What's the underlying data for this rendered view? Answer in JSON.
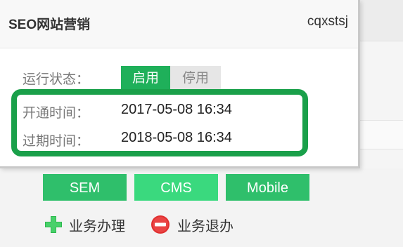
{
  "popup": {
    "title": "SEO网站营销",
    "user": "cqxstsj"
  },
  "status": {
    "label": "运行状态：",
    "on_label": "启用",
    "off_label": "停用",
    "selected": "启用"
  },
  "dates": {
    "open_label": "开通时间：",
    "open_value": "2017-05-08 16:34",
    "expire_label": "过期时间：",
    "expire_value": "2018-05-08 16:34"
  },
  "product_buttons": {
    "sem": "SEM",
    "cms": "CMS",
    "mobile": "Mobile"
  },
  "actions": {
    "apply_label": "业务办理",
    "apply_icon": "plus-icon",
    "cancel_label": "业务退办",
    "cancel_icon": "minus-icon"
  },
  "colors": {
    "accent_green": "#1fb05a",
    "highlight_green": "#1aa04a",
    "button_green": "#2fbf6b",
    "button_green_light": "#3ad97e",
    "cancel_red": "#e03030"
  }
}
